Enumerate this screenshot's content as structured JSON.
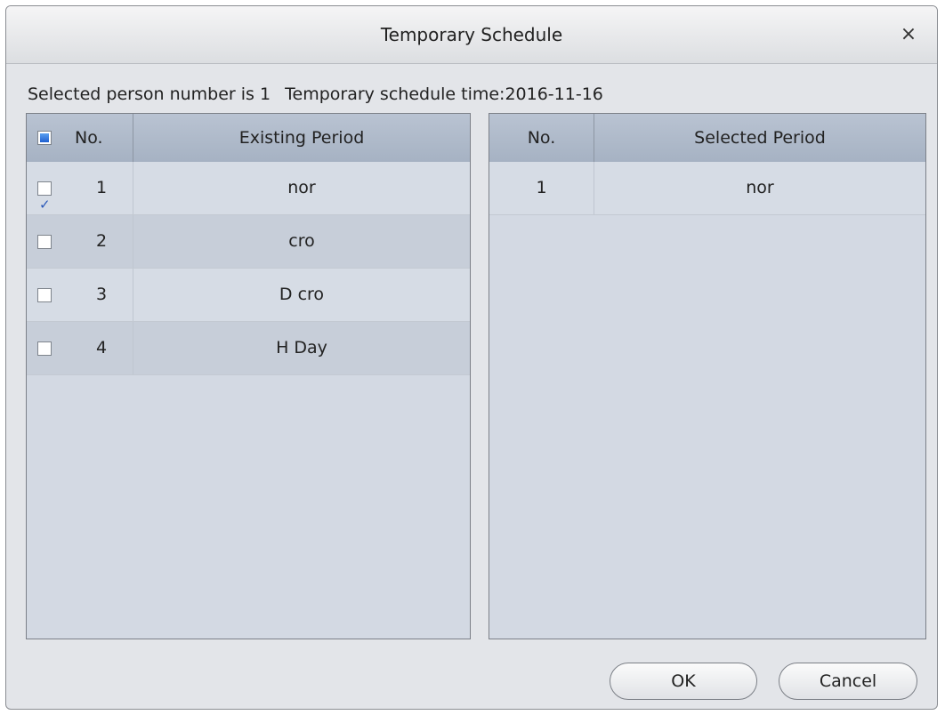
{
  "dialog": {
    "title": "Temporary Schedule",
    "close_glyph": "×"
  },
  "info": {
    "person_text": "Selected person number is 1",
    "schedule_text": "Temporary schedule time:2016-11-16"
  },
  "existing_table": {
    "header_checkbox_state": "partial",
    "columns": [
      "No.",
      "Existing Period"
    ],
    "rows": [
      {
        "checked": true,
        "no": "1",
        "period": "nor"
      },
      {
        "checked": false,
        "no": "2",
        "period": "cro"
      },
      {
        "checked": false,
        "no": "3",
        "period": "D cro"
      },
      {
        "checked": false,
        "no": "4",
        "period": "H Day"
      }
    ]
  },
  "selected_table": {
    "columns": [
      "No.",
      "Selected Period"
    ],
    "rows": [
      {
        "no": "1",
        "period": "nor"
      }
    ]
  },
  "buttons": {
    "ok": "OK",
    "cancel": "Cancel"
  }
}
